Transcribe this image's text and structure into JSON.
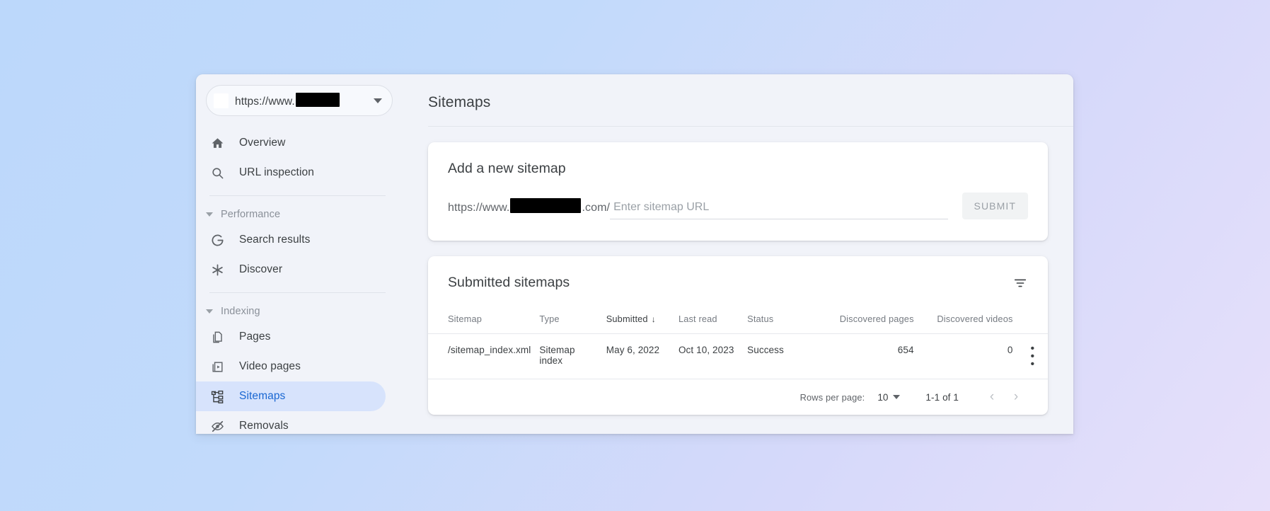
{
  "property": {
    "url_text": "https://www.",
    "redacted": true,
    "dropdown_icon": "chevron-down-icon",
    "favicon": "site-favicon"
  },
  "sidebar": {
    "groups": [
      {
        "type": "items",
        "items": [
          {
            "label": "Overview",
            "icon": "home-icon",
            "selected": false
          },
          {
            "label": "URL inspection",
            "icon": "search-icon",
            "selected": false
          }
        ]
      },
      {
        "type": "section",
        "section_label": "Performance",
        "items": [
          {
            "label": "Search results",
            "icon": "google-g-icon",
            "selected": false
          },
          {
            "label": "Discover",
            "icon": "asterisk-icon",
            "selected": false
          }
        ]
      },
      {
        "type": "section",
        "section_label": "Indexing",
        "items": [
          {
            "label": "Pages",
            "icon": "pages-copy-icon",
            "selected": false
          },
          {
            "label": "Video pages",
            "icon": "video-page-icon",
            "selected": false
          },
          {
            "label": "Sitemaps",
            "icon": "sitemap-tree-icon",
            "selected": true
          },
          {
            "label": "Removals",
            "icon": "eye-off-icon",
            "selected": false
          }
        ]
      }
    ]
  },
  "page": {
    "title": "Sitemaps"
  },
  "add_sitemap": {
    "title": "Add a new sitemap",
    "url_prefix": "https://www.",
    "url_suffix": ".com/",
    "input_value": "",
    "input_placeholder": "Enter sitemap URL",
    "submit_label": "SUBMIT"
  },
  "submitted": {
    "title": "Submitted sitemaps",
    "filter_icon": "filter-list-icon",
    "columns": [
      {
        "key": "sitemap",
        "label": "Sitemap",
        "align": "left"
      },
      {
        "key": "type",
        "label": "Type",
        "align": "left"
      },
      {
        "key": "submitted",
        "label": "Submitted",
        "align": "left",
        "sorted": true,
        "sort_dir": "↓"
      },
      {
        "key": "last_read",
        "label": "Last read",
        "align": "left"
      },
      {
        "key": "status",
        "label": "Status",
        "align": "left"
      },
      {
        "key": "discovered_pages",
        "label": "Discovered pages",
        "align": "right"
      },
      {
        "key": "discovered_videos",
        "label": "Discovered videos",
        "align": "right"
      }
    ],
    "rows": [
      {
        "sitemap": "/sitemap_index.xml",
        "type": "Sitemap index",
        "submitted": "May 6, 2022",
        "last_read": "Oct 10, 2023",
        "status": "Success",
        "status_color": "#34a853",
        "discovered_pages": "654",
        "discovered_videos": "0",
        "menu_icon": "more-vert-icon"
      }
    ],
    "pagination": {
      "rows_per_page_label": "Rows per page:",
      "rows_per_page_value": "10",
      "range_label": "1-1 of 1",
      "prev_icon": "‹",
      "next_icon": "›"
    }
  },
  "colors": {
    "accent": "#1967d2",
    "selected_pill": "#d7e3fc",
    "success": "#34a853",
    "text_primary": "#3c4043",
    "text_secondary": "#5f6368",
    "bg_top_left": "#bcd8fb",
    "bg_bottom_right": "#e7e0fa",
    "content_bg": "#f1f3f9"
  }
}
